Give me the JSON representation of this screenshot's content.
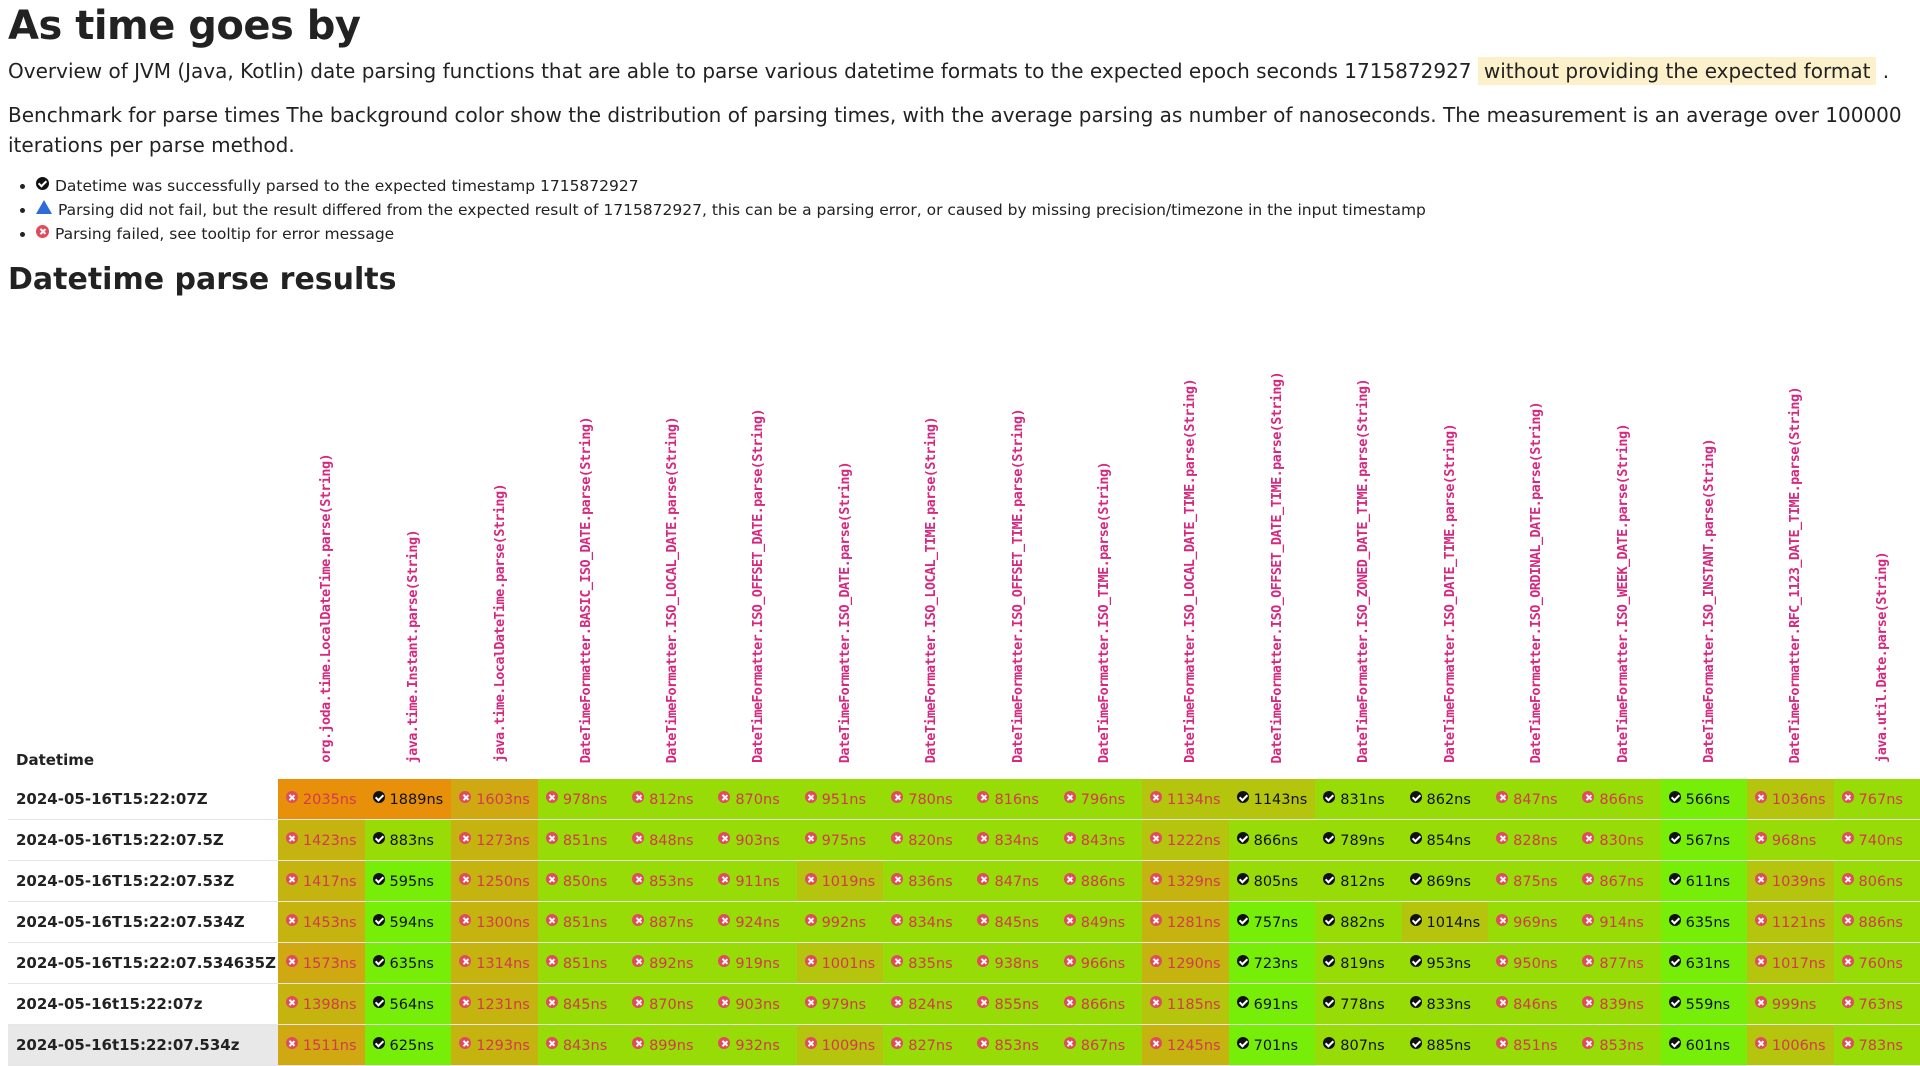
{
  "page": {
    "title": "As time goes by",
    "intro_text": "Overview of JVM (Java, Kotlin) date parsing functions that are able to parse various datetime formats to the expected epoch seconds 1715872927",
    "intro_highlight": "without providing the expected format",
    "intro_end": ".",
    "benchmark_text": "Benchmark for parse times The background color show the distribution of parsing times, with the average parsing as number of nanoseconds. The measurement is an average over 100000 iterations per parse method.",
    "legend": [
      {
        "icon": "check-circle-icon",
        "text": "Datetime was successfully parsed to the expected timestamp 1715872927"
      },
      {
        "icon": "warning-triangle-icon",
        "text": "Parsing did not fail, but the result differed from the expected result of 1715872927, this can be a parsing error, or caused by missing precision/timezone in the input timestamp"
      },
      {
        "icon": "error-circle-icon",
        "text": "Parsing failed, see tooltip for error message"
      }
    ],
    "section_title": "Datetime parse results"
  },
  "table": {
    "corner_label": "Datetime",
    "colors": {
      "orange": "#e8900a",
      "yellow_green": "#b5c40c",
      "lime": "#97dc06",
      "green": "#76ee08",
      "tan": "#c5b40f",
      "mustard": "#d0a812"
    },
    "methods": [
      "org.joda.time.LocalDateTime.parse(String)",
      "java.time.Instant.parse(String)",
      "java.time.LocalDateTime.parse(String)",
      "DateTimeFormatter.BASIC_ISO_DATE.parse(String)",
      "DateTimeFormatter.ISO_LOCAL_DATE.parse(String)",
      "DateTimeFormatter.ISO_OFFSET_DATE.parse(String)",
      "DateTimeFormatter.ISO_DATE.parse(String)",
      "DateTimeFormatter.ISO_LOCAL_TIME.parse(String)",
      "DateTimeFormatter.ISO_OFFSET_TIME.parse(String)",
      "DateTimeFormatter.ISO_TIME.parse(String)",
      "DateTimeFormatter.ISO_LOCAL_DATE_TIME.parse(String)",
      "DateTimeFormatter.ISO_OFFSET_DATE_TIME.parse(String)",
      "DateTimeFormatter.ISO_ZONED_DATE_TIME.parse(String)",
      "DateTimeFormatter.ISO_DATE_TIME.parse(String)",
      "DateTimeFormatter.ISO_ORDINAL_DATE.parse(String)",
      "DateTimeFormatter.ISO_WEEK_DATE.parse(String)",
      "DateTimeFormatter.ISO_INSTANT.parse(String)",
      "DateTimeFormatter.RFC_1123_DATE_TIME.parse(String)",
      "java.util.Date.parse(String)"
    ],
    "rows": [
      {
        "datetime": "2024-05-16T15:22:07Z",
        "cells": [
          {
            "s": "fail",
            "v": "2035ns",
            "c": "orange"
          },
          {
            "s": "ok",
            "v": "1889ns",
            "c": "orange"
          },
          {
            "s": "fail",
            "v": "1603ns",
            "c": "mustard"
          },
          {
            "s": "fail",
            "v": "978ns",
            "c": "lime"
          },
          {
            "s": "fail",
            "v": "812ns",
            "c": "lime"
          },
          {
            "s": "fail",
            "v": "870ns",
            "c": "lime"
          },
          {
            "s": "fail",
            "v": "951ns",
            "c": "lime"
          },
          {
            "s": "fail",
            "v": "780ns",
            "c": "lime"
          },
          {
            "s": "fail",
            "v": "816ns",
            "c": "lime"
          },
          {
            "s": "fail",
            "v": "796ns",
            "c": "lime"
          },
          {
            "s": "fail",
            "v": "1134ns",
            "c": "yellow_green"
          },
          {
            "s": "ok",
            "v": "1143ns",
            "c": "yellow_green"
          },
          {
            "s": "ok",
            "v": "831ns",
            "c": "lime"
          },
          {
            "s": "ok",
            "v": "862ns",
            "c": "lime"
          },
          {
            "s": "fail",
            "v": "847ns",
            "c": "lime"
          },
          {
            "s": "fail",
            "v": "866ns",
            "c": "lime"
          },
          {
            "s": "ok",
            "v": "566ns",
            "c": "green"
          },
          {
            "s": "fail",
            "v": "1036ns",
            "c": "yellow_green"
          },
          {
            "s": "fail",
            "v": "767ns",
            "c": "lime"
          }
        ]
      },
      {
        "datetime": "2024-05-16T15:22:07.5Z",
        "cells": [
          {
            "s": "fail",
            "v": "1423ns",
            "c": "tan"
          },
          {
            "s": "ok",
            "v": "883ns",
            "c": "lime"
          },
          {
            "s": "fail",
            "v": "1273ns",
            "c": "tan"
          },
          {
            "s": "fail",
            "v": "851ns",
            "c": "lime"
          },
          {
            "s": "fail",
            "v": "848ns",
            "c": "lime"
          },
          {
            "s": "fail",
            "v": "903ns",
            "c": "lime"
          },
          {
            "s": "fail",
            "v": "975ns",
            "c": "lime"
          },
          {
            "s": "fail",
            "v": "820ns",
            "c": "lime"
          },
          {
            "s": "fail",
            "v": "834ns",
            "c": "lime"
          },
          {
            "s": "fail",
            "v": "843ns",
            "c": "lime"
          },
          {
            "s": "fail",
            "v": "1222ns",
            "c": "yellow_green"
          },
          {
            "s": "ok",
            "v": "866ns",
            "c": "lime"
          },
          {
            "s": "ok",
            "v": "789ns",
            "c": "lime"
          },
          {
            "s": "ok",
            "v": "854ns",
            "c": "lime"
          },
          {
            "s": "fail",
            "v": "828ns",
            "c": "lime"
          },
          {
            "s": "fail",
            "v": "830ns",
            "c": "lime"
          },
          {
            "s": "ok",
            "v": "567ns",
            "c": "green"
          },
          {
            "s": "fail",
            "v": "968ns",
            "c": "lime"
          },
          {
            "s": "fail",
            "v": "740ns",
            "c": "lime"
          }
        ]
      },
      {
        "datetime": "2024-05-16T15:22:07.53Z",
        "cells": [
          {
            "s": "fail",
            "v": "1417ns",
            "c": "tan"
          },
          {
            "s": "ok",
            "v": "595ns",
            "c": "green"
          },
          {
            "s": "fail",
            "v": "1250ns",
            "c": "tan"
          },
          {
            "s": "fail",
            "v": "850ns",
            "c": "lime"
          },
          {
            "s": "fail",
            "v": "853ns",
            "c": "lime"
          },
          {
            "s": "fail",
            "v": "911ns",
            "c": "lime"
          },
          {
            "s": "fail",
            "v": "1019ns",
            "c": "yellow_green"
          },
          {
            "s": "fail",
            "v": "836ns",
            "c": "lime"
          },
          {
            "s": "fail",
            "v": "847ns",
            "c": "lime"
          },
          {
            "s": "fail",
            "v": "886ns",
            "c": "lime"
          },
          {
            "s": "fail",
            "v": "1329ns",
            "c": "tan"
          },
          {
            "s": "ok",
            "v": "805ns",
            "c": "lime"
          },
          {
            "s": "ok",
            "v": "812ns",
            "c": "lime"
          },
          {
            "s": "ok",
            "v": "869ns",
            "c": "lime"
          },
          {
            "s": "fail",
            "v": "875ns",
            "c": "lime"
          },
          {
            "s": "fail",
            "v": "867ns",
            "c": "lime"
          },
          {
            "s": "ok",
            "v": "611ns",
            "c": "green"
          },
          {
            "s": "fail",
            "v": "1039ns",
            "c": "yellow_green"
          },
          {
            "s": "fail",
            "v": "806ns",
            "c": "lime"
          }
        ]
      },
      {
        "datetime": "2024-05-16T15:22:07.534Z",
        "cells": [
          {
            "s": "fail",
            "v": "1453ns",
            "c": "tan"
          },
          {
            "s": "ok",
            "v": "594ns",
            "c": "green"
          },
          {
            "s": "fail",
            "v": "1300ns",
            "c": "tan"
          },
          {
            "s": "fail",
            "v": "851ns",
            "c": "lime"
          },
          {
            "s": "fail",
            "v": "887ns",
            "c": "lime"
          },
          {
            "s": "fail",
            "v": "924ns",
            "c": "lime"
          },
          {
            "s": "fail",
            "v": "992ns",
            "c": "lime"
          },
          {
            "s": "fail",
            "v": "834ns",
            "c": "lime"
          },
          {
            "s": "fail",
            "v": "845ns",
            "c": "lime"
          },
          {
            "s": "fail",
            "v": "849ns",
            "c": "lime"
          },
          {
            "s": "fail",
            "v": "1281ns",
            "c": "tan"
          },
          {
            "s": "ok",
            "v": "757ns",
            "c": "green"
          },
          {
            "s": "ok",
            "v": "882ns",
            "c": "lime"
          },
          {
            "s": "ok",
            "v": "1014ns",
            "c": "yellow_green"
          },
          {
            "s": "fail",
            "v": "969ns",
            "c": "lime"
          },
          {
            "s": "fail",
            "v": "914ns",
            "c": "lime"
          },
          {
            "s": "ok",
            "v": "635ns",
            "c": "green"
          },
          {
            "s": "fail",
            "v": "1121ns",
            "c": "yellow_green"
          },
          {
            "s": "fail",
            "v": "886ns",
            "c": "lime"
          }
        ]
      },
      {
        "datetime": "2024-05-16T15:22:07.534635Z",
        "cells": [
          {
            "s": "fail",
            "v": "1573ns",
            "c": "mustard"
          },
          {
            "s": "ok",
            "v": "635ns",
            "c": "green"
          },
          {
            "s": "fail",
            "v": "1314ns",
            "c": "tan"
          },
          {
            "s": "fail",
            "v": "851ns",
            "c": "lime"
          },
          {
            "s": "fail",
            "v": "892ns",
            "c": "lime"
          },
          {
            "s": "fail",
            "v": "919ns",
            "c": "lime"
          },
          {
            "s": "fail",
            "v": "1001ns",
            "c": "yellow_green"
          },
          {
            "s": "fail",
            "v": "835ns",
            "c": "lime"
          },
          {
            "s": "fail",
            "v": "938ns",
            "c": "lime"
          },
          {
            "s": "fail",
            "v": "966ns",
            "c": "lime"
          },
          {
            "s": "fail",
            "v": "1290ns",
            "c": "tan"
          },
          {
            "s": "ok",
            "v": "723ns",
            "c": "green"
          },
          {
            "s": "ok",
            "v": "819ns",
            "c": "lime"
          },
          {
            "s": "ok",
            "v": "953ns",
            "c": "lime"
          },
          {
            "s": "fail",
            "v": "950ns",
            "c": "lime"
          },
          {
            "s": "fail",
            "v": "877ns",
            "c": "lime"
          },
          {
            "s": "ok",
            "v": "631ns",
            "c": "green"
          },
          {
            "s": "fail",
            "v": "1017ns",
            "c": "yellow_green"
          },
          {
            "s": "fail",
            "v": "760ns",
            "c": "lime"
          }
        ]
      },
      {
        "datetime": "2024-05-16t15:22:07z",
        "cells": [
          {
            "s": "fail",
            "v": "1398ns",
            "c": "tan"
          },
          {
            "s": "ok",
            "v": "564ns",
            "c": "green"
          },
          {
            "s": "fail",
            "v": "1231ns",
            "c": "tan"
          },
          {
            "s": "fail",
            "v": "845ns",
            "c": "lime"
          },
          {
            "s": "fail",
            "v": "870ns",
            "c": "lime"
          },
          {
            "s": "fail",
            "v": "903ns",
            "c": "lime"
          },
          {
            "s": "fail",
            "v": "979ns",
            "c": "lime"
          },
          {
            "s": "fail",
            "v": "824ns",
            "c": "lime"
          },
          {
            "s": "fail",
            "v": "855ns",
            "c": "lime"
          },
          {
            "s": "fail",
            "v": "866ns",
            "c": "lime"
          },
          {
            "s": "fail",
            "v": "1185ns",
            "c": "yellow_green"
          },
          {
            "s": "ok",
            "v": "691ns",
            "c": "green"
          },
          {
            "s": "ok",
            "v": "778ns",
            "c": "lime"
          },
          {
            "s": "ok",
            "v": "833ns",
            "c": "lime"
          },
          {
            "s": "fail",
            "v": "846ns",
            "c": "lime"
          },
          {
            "s": "fail",
            "v": "839ns",
            "c": "lime"
          },
          {
            "s": "ok",
            "v": "559ns",
            "c": "green"
          },
          {
            "s": "fail",
            "v": "999ns",
            "c": "lime"
          },
          {
            "s": "fail",
            "v": "763ns",
            "c": "lime"
          }
        ]
      },
      {
        "datetime": "2024-05-16t15:22:07.534z",
        "cells": [
          {
            "s": "fail",
            "v": "1511ns",
            "c": "mustard"
          },
          {
            "s": "ok",
            "v": "625ns",
            "c": "green"
          },
          {
            "s": "fail",
            "v": "1293ns",
            "c": "tan"
          },
          {
            "s": "fail",
            "v": "843ns",
            "c": "lime"
          },
          {
            "s": "fail",
            "v": "899ns",
            "c": "lime"
          },
          {
            "s": "fail",
            "v": "932ns",
            "c": "lime"
          },
          {
            "s": "fail",
            "v": "1009ns",
            "c": "yellow_green"
          },
          {
            "s": "fail",
            "v": "827ns",
            "c": "lime"
          },
          {
            "s": "fail",
            "v": "853ns",
            "c": "lime"
          },
          {
            "s": "fail",
            "v": "867ns",
            "c": "lime"
          },
          {
            "s": "fail",
            "v": "1245ns",
            "c": "tan"
          },
          {
            "s": "ok",
            "v": "701ns",
            "c": "green"
          },
          {
            "s": "ok",
            "v": "807ns",
            "c": "lime"
          },
          {
            "s": "ok",
            "v": "885ns",
            "c": "lime"
          },
          {
            "s": "fail",
            "v": "851ns",
            "c": "lime"
          },
          {
            "s": "fail",
            "v": "853ns",
            "c": "lime"
          },
          {
            "s": "ok",
            "v": "601ns",
            "c": "green"
          },
          {
            "s": "fail",
            "v": "1006ns",
            "c": "yellow_green"
          },
          {
            "s": "fail",
            "v": "783ns",
            "c": "lime"
          }
        ]
      }
    ]
  }
}
